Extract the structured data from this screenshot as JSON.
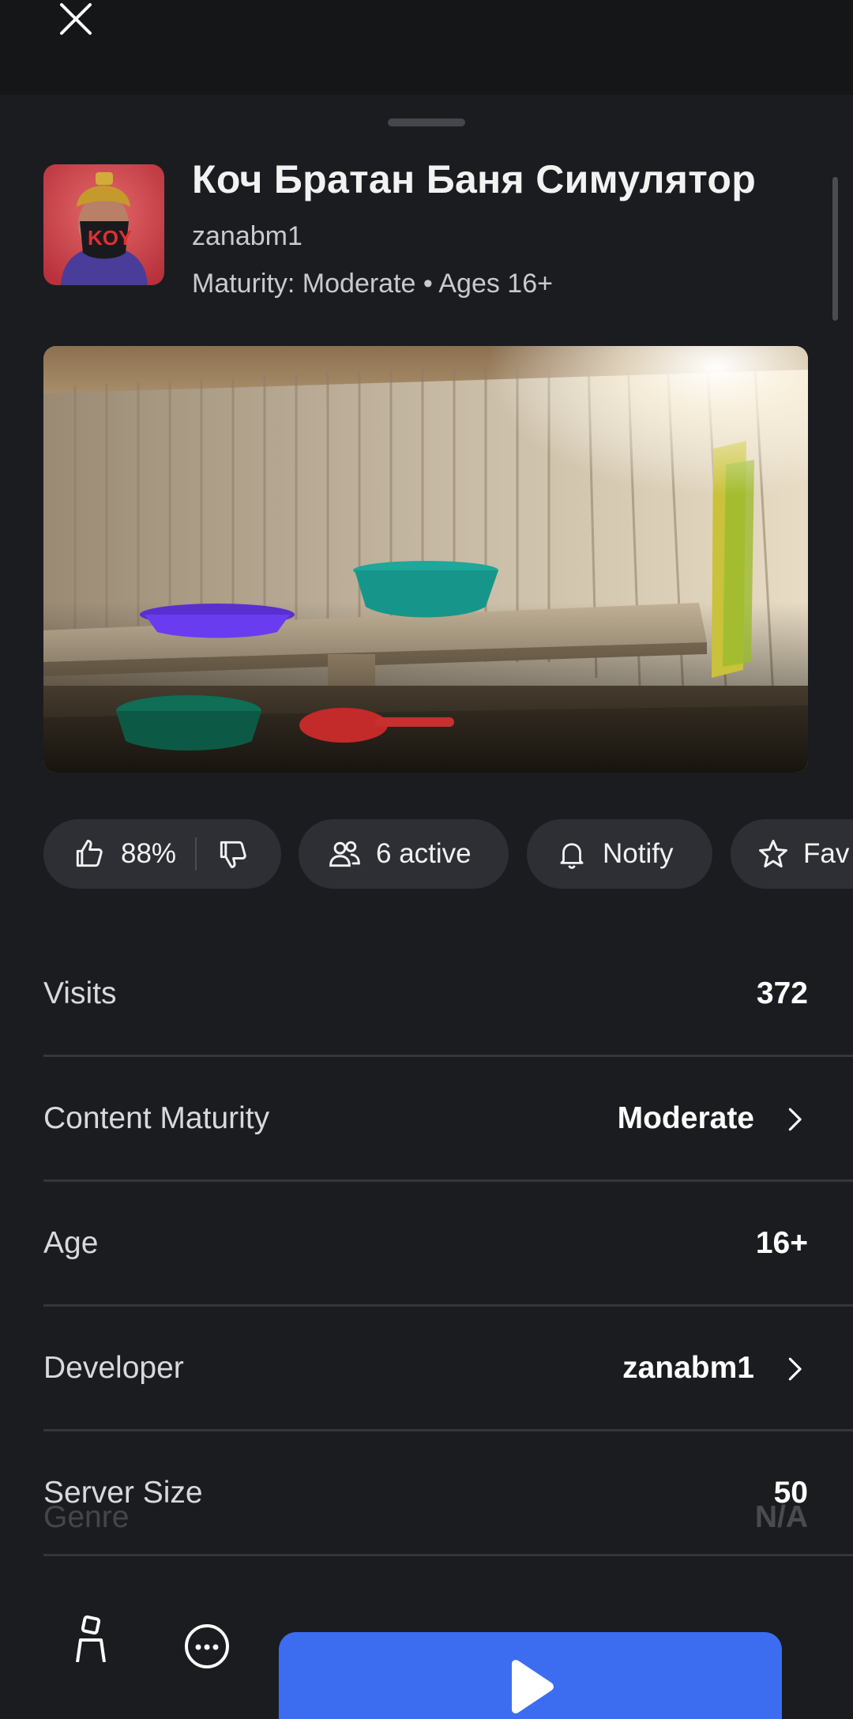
{
  "header": {
    "close_icon": "close-icon"
  },
  "game": {
    "title": "Коч Братан Баня Симулятор",
    "creator": "zanabm1",
    "maturity_line": "Maturity: Moderate • Ages 16+"
  },
  "actions": {
    "rating": "88%",
    "active": "6 active",
    "notify": "Notify",
    "favorite": "Fav"
  },
  "stats": [
    {
      "label": "Visits",
      "value": "372"
    },
    {
      "label": "Content Maturity",
      "value": "Moderate"
    },
    {
      "label": "Age",
      "value": "16+"
    },
    {
      "label": "Developer",
      "value": "zanabm1"
    },
    {
      "label": "Server Size",
      "value": "50"
    }
  ],
  "stats_faded": {
    "label": "Genre",
    "value": "N/A"
  },
  "bottom": {
    "left_icon": "avatar-icon",
    "chat_icon": "chat-icon",
    "play_icon": "play-icon"
  },
  "colors": {
    "accent": "#3c6df0",
    "background": "#1b1c20",
    "pill": "#2d2f35"
  }
}
